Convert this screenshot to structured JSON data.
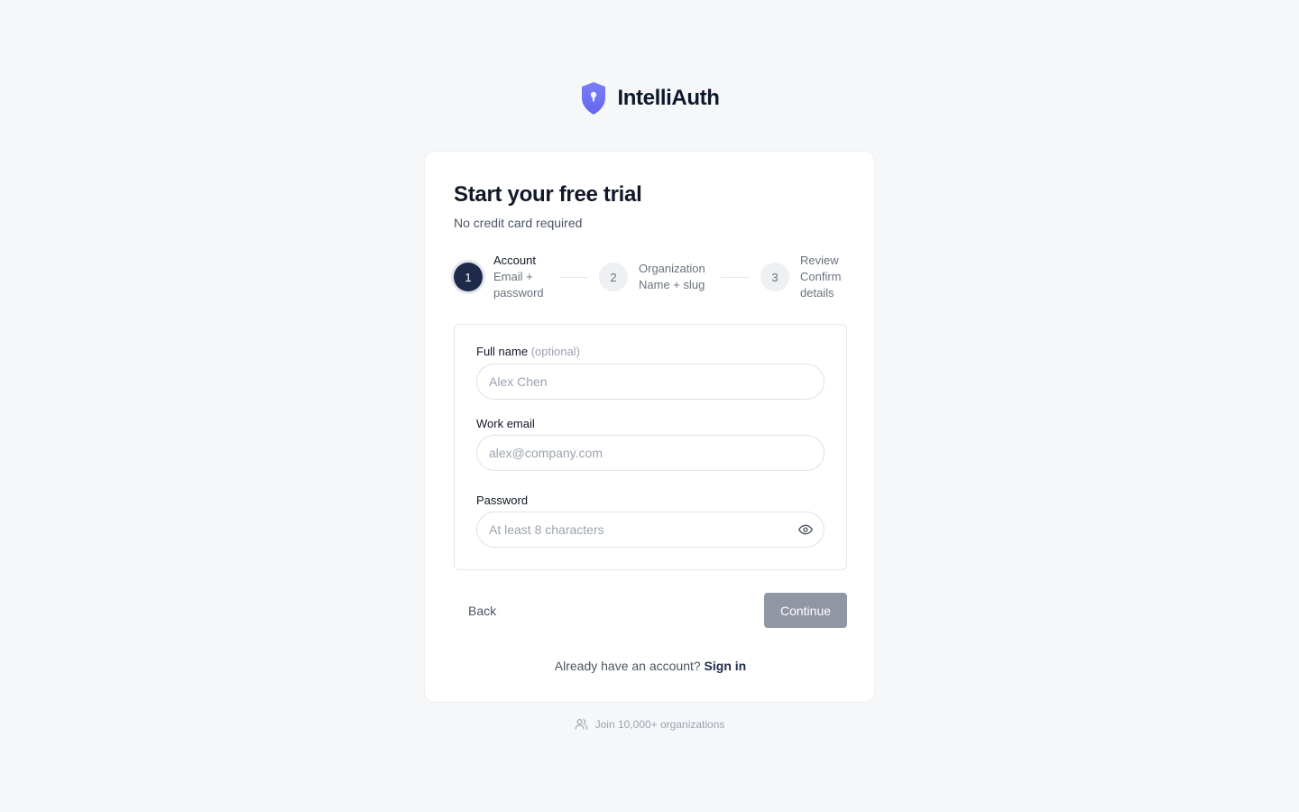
{
  "brand": {
    "name": "IntelliAuth",
    "logo_icon": "shield-icon",
    "logo_color": "#6366f1"
  },
  "card": {
    "title": "Start your free trial",
    "subtitle": "No credit card required"
  },
  "stepper": {
    "steps": [
      {
        "number": "1",
        "label": "Account",
        "desc_line1": "Email +",
        "desc_line2": "password",
        "state": "active"
      },
      {
        "number": "2",
        "label": "Organization",
        "desc_line1": "Name + slug",
        "state": "inactive"
      },
      {
        "number": "3",
        "label": "Review",
        "desc_line1": "Confirm",
        "desc_line2": "details",
        "state": "inactive"
      }
    ],
    "active_color": "#1e2a4a"
  },
  "form": {
    "full_name": {
      "label": "Full name",
      "optional_text": "(optional)",
      "placeholder": "Alex Chen",
      "value": ""
    },
    "work_email": {
      "label": "Work email",
      "placeholder": "alex@company.com",
      "value": ""
    },
    "password": {
      "label": "Password",
      "placeholder": "At least 8 characters",
      "value": "",
      "toggle_icon": "eye-icon"
    }
  },
  "actions": {
    "back_label": "Back",
    "continue_label": "Continue",
    "continue_color": "#9196a4"
  },
  "signin": {
    "prompt": "Already have an account?",
    "link_label": "Sign in"
  },
  "footer": {
    "icon": "users-icon",
    "text": "Join 10,000+ organizations"
  }
}
